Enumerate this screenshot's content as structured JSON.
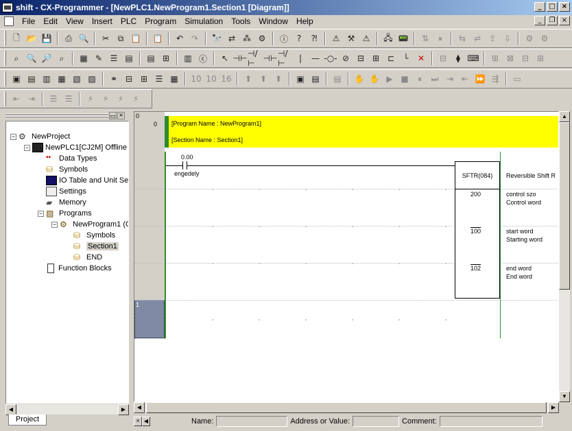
{
  "window": {
    "title": "shift - CX-Programmer - [NewPLC1.NewProgram1.Section1 [Diagram]]"
  },
  "menu": {
    "items": [
      "File",
      "Edit",
      "View",
      "Insert",
      "PLC",
      "Program",
      "Simulation",
      "Tools",
      "Window",
      "Help"
    ]
  },
  "tree": {
    "project": "NewProject",
    "plc": "NewPLC1[CJ2M] Offline",
    "data_types": "Data Types",
    "symbols": "Symbols",
    "io_table": "IO Table and Unit Se",
    "settings": "Settings",
    "memory": "Memory",
    "programs": "Programs",
    "program1": "NewProgram1 (C",
    "prog_symbols": "Symbols",
    "section1": "Section1",
    "end": "END",
    "function_blocks": "Function Blocks"
  },
  "project_tab": "Project",
  "ladder": {
    "rung0_row": "0",
    "rung0_step": "0",
    "rung1_row": "1",
    "comment_program": "[Program Name : NewProgram1]",
    "comment_section": "[Section Name : Section1]",
    "contact_address": "0.00",
    "contact_comment": "engedely",
    "instruction": "SFTR(084)",
    "instruction_comment": "Reversible Shift R",
    "op1_value": "200",
    "op1_label": "control szo",
    "op1_comment": "Control word",
    "op2_value": "100",
    "op2_label": "start word",
    "op2_comment": "Starting word",
    "op3_value": "102",
    "op3_label": "end word",
    "op3_comment": "End word"
  },
  "status": {
    "name_label": "Name:",
    "address_label": "Address or Value:",
    "comment_label": "Comment:"
  }
}
